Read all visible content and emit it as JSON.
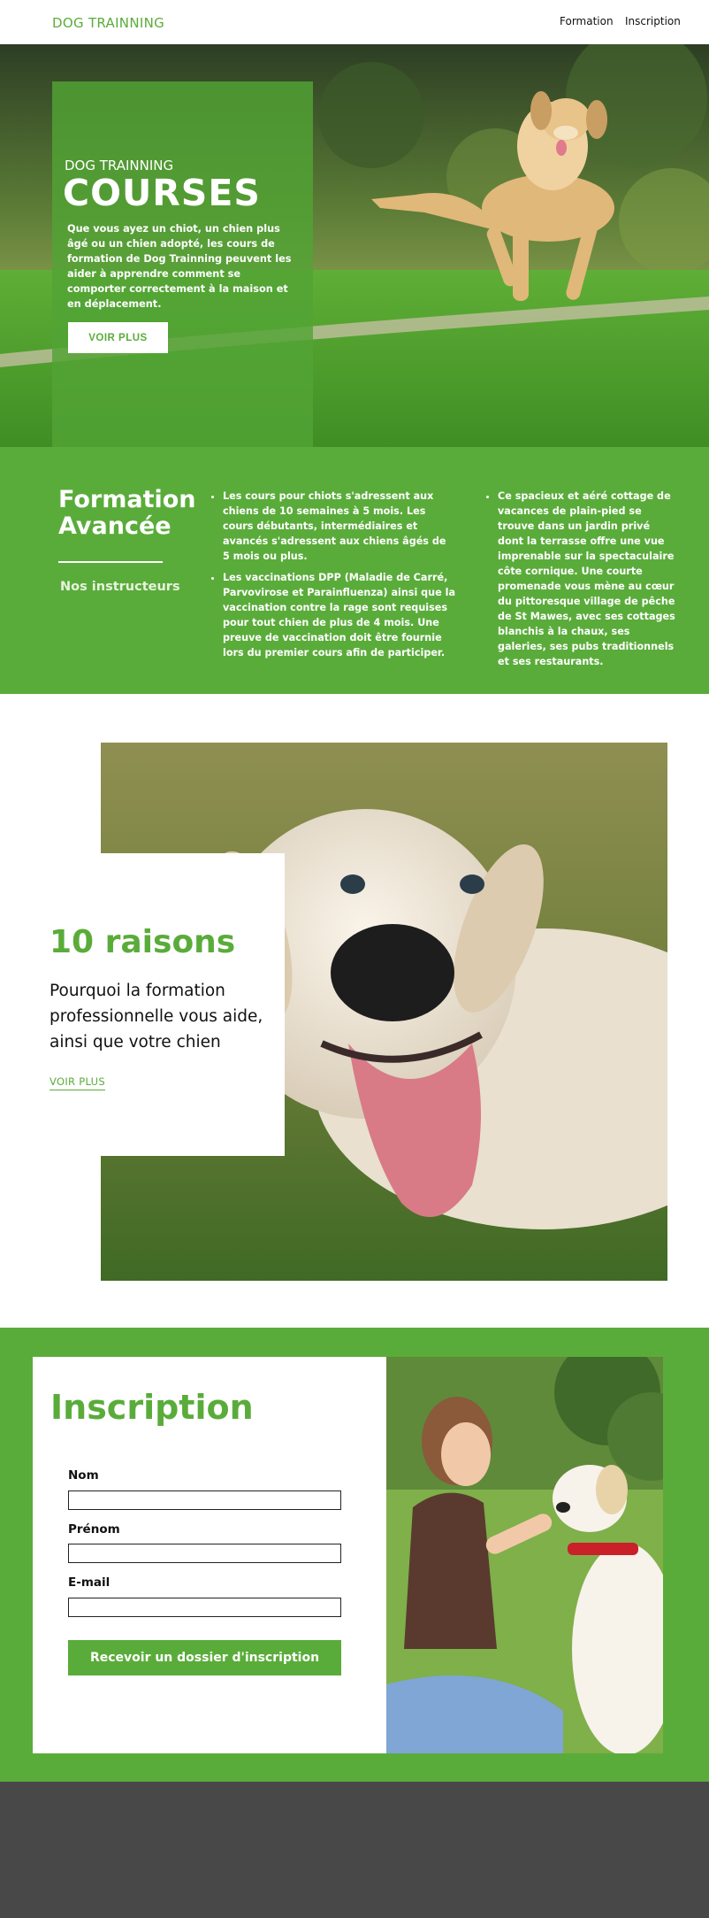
{
  "header": {
    "logo": "DOG TRAINNING",
    "nav": [
      "Formation",
      "Inscription"
    ]
  },
  "hero": {
    "kicker": "DOG TRAINNING",
    "title": "COURSES",
    "text": "Que vous ayez un chiot, un chien plus âgé ou un chien adopté, les cours de formation de Dog Trainning peuvent les aider à apprendre comment se comporter correctement à la maison et en déplacement.",
    "button": "VOIR PLUS"
  },
  "formation": {
    "title": "Formation Avancée",
    "subtitle": "Nos instructeurs",
    "bullets_left": [
      "Les cours pour chiots s'adressent aux chiens de 10 semaines à 5 mois. Les cours débutants, intermédiaires et avancés s'adressent aux chiens âgés de 5 mois ou plus.",
      "Les vaccinations DPP (Maladie de Carré, Parvovirose et Parainfluenza) ainsi que la vaccination contre la rage sont requises pour tout chien de plus de 4 mois. Une preuve de vaccination doit être fournie lors du premier cours afin de participer."
    ],
    "bullets_right": [
      "Ce spacieux et aéré cottage de vacances de plain-pied se trouve dans un jardin privé dont la terrasse offre une vue imprenable sur la spectaculaire côte cornique. Une courte promenade vous mène au cœur du pittoresque village de pêche de St Mawes, avec ses cottages blanchis à la chaux, ses galeries, ses pubs traditionnels et ses restaurants."
    ]
  },
  "raisons": {
    "title": "10 raisons",
    "text": "Pourquoi la formation professionnelle vous aide, ainsi que votre chien",
    "link": "VOIR PLUS"
  },
  "inscription": {
    "title": "Inscription",
    "fields": {
      "nom": "Nom",
      "prenom": "Prénom",
      "email": "E-mail"
    },
    "submit": "Recevoir un dossier d'inscription"
  },
  "colors": {
    "accent": "#5aac3a",
    "footer": "#484848"
  }
}
